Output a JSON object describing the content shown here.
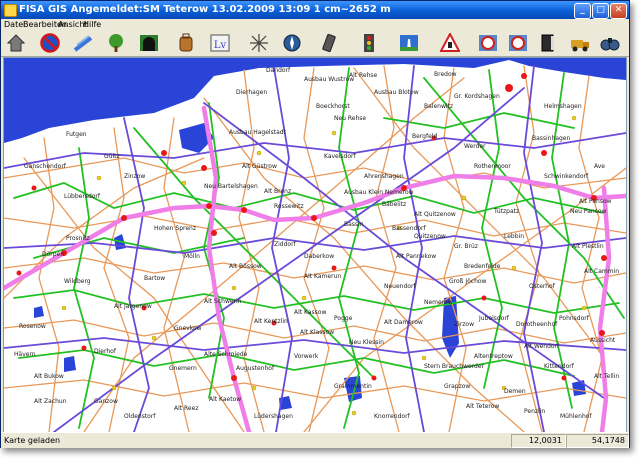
{
  "window": {
    "title": "FISA GIS Angemeldet:SM Teterow 13.02.2009 13:09 1 cm~2652 m",
    "minimize": "_",
    "maximize": "□",
    "close": "✕"
  },
  "menu": [
    "Datei",
    "Bearbeiten",
    "Ansicht",
    "Hilfe"
  ],
  "toolbar": [
    {
      "name": "home-icon"
    },
    {
      "name": "no-entry-icon"
    },
    {
      "name": "road-icon"
    },
    {
      "name": "tree-icon"
    },
    {
      "name": "tunnel-icon"
    },
    {
      "name": "backpack-icon"
    },
    {
      "name": "text-lv-icon",
      "text": "Lv"
    },
    {
      "name": "star-icon"
    },
    {
      "name": "compass-icon"
    },
    {
      "name": "handheld-icon"
    },
    {
      "name": "traffic-light-icon"
    },
    {
      "name": "highway-icon"
    },
    {
      "name": "warning-sign-icon"
    },
    {
      "name": "speed-limit-icon"
    },
    {
      "name": "speed-sign-icon"
    },
    {
      "name": "book-icon"
    },
    {
      "name": "truck-icon"
    },
    {
      "name": "binoculars-icon"
    }
  ],
  "map": {
    "places": [
      "Dändorf",
      "Ausbau Wustrow",
      "Alt Rehse",
      "Dierhagen",
      "Boeckhorst",
      "Ausbau Blotow",
      "Ausbau Hagelstadt",
      "Neu Rehse",
      "Gr. Kordshagen",
      "Bassin",
      "Bäbelitz",
      "Alt Quitzenow",
      "Bassendorf",
      "Alt Pannekow",
      "Groß Jöchow",
      "Alt Kamerun",
      "Alt Klassow",
      "Pogge",
      "Neu Klessin",
      "Alt Kassow",
      "Alt Plestlin",
      "Alt Pansow",
      "Futgen",
      "Bartow",
      "Prosnitz",
      "Dörpen",
      "Dierhof",
      "Alt Bukow",
      "Alt Schwerin",
      "Alte Schmiede",
      "Gnemern",
      "Augustenhof",
      "Alt Kaetow",
      "Osterhof",
      "Hävern",
      "Alt Zachun",
      "Ganzow",
      "Alt Reez",
      "Oldenstorf",
      "Bredow",
      "Bassinhagen",
      "Demen",
      "Ausbau Klein Nemerow",
      "Stern Brauchwerder",
      "Alt Teterow",
      "Gr. Brüz",
      "Jubelsdorf",
      "Alt Wendorf",
      "Pohnsdorf",
      "Helmshagen",
      "Dorotheenhof",
      "Alt Cammin",
      "Aussicht",
      "Mühlenhof",
      "Schwinkendorf",
      "Quitzenow",
      "Rothenmoor",
      "Neu Pansow",
      "Alt Güstrow",
      "Alt Brenz",
      "Rossewitz",
      "Ziddorf",
      "Alt Bössow",
      "Hohen Sprenz",
      "Nemerow",
      "Lüdershagen",
      "Neu Bartelshagen",
      "Neuendorf",
      "Altentreptow",
      "Alt Damerow",
      "Bergfeld",
      "Zinzow",
      "Vorwerk",
      "Grapzow",
      "Kavelsdorf",
      "Alt Jargenow",
      "Gnevkow",
      "Lebbin",
      "Balenwitz",
      "Ahrenshagen",
      "Tützpatz",
      "Grammentin",
      "Alt Kentzlin",
      "Mölln",
      "Kittendorf",
      "Penzlin",
      "Zirzow",
      "Lübbersdorf",
      "Rosenow",
      "Wildberg",
      "Gültz",
      "Werder",
      "Bredenfelde",
      "Ganschendorf",
      "Knorrendorf",
      "Ave",
      "Alt Tellin",
      "Daberkow"
    ]
  },
  "status": {
    "message": "Karte geladen",
    "coord": "12,0031",
    "value": "54,1748"
  }
}
